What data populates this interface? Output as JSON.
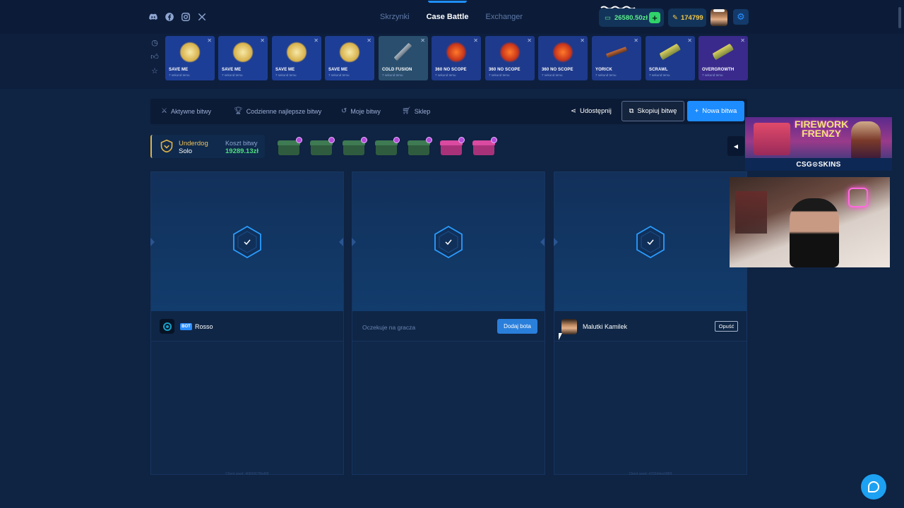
{
  "nav": {
    "links": [
      "Skrzynki",
      "Case Battle",
      "Exchanger"
    ],
    "active": "Case Battle"
  },
  "wallet": {
    "balance": "26580.50zł",
    "coins": "174799"
  },
  "drops": [
    {
      "name": "SAVE ME",
      "sub": "7 sekund temu",
      "color": "#1d3e96",
      "icon": "gold-cat-icon"
    },
    {
      "name": "SAVE ME",
      "sub": "7 sekund temu",
      "color": "#1d3e96",
      "icon": "gold-cat-icon"
    },
    {
      "name": "SAVE ME",
      "sub": "7 sekund temu",
      "color": "#1d3e96",
      "icon": "gold-cat-icon"
    },
    {
      "name": "SAVE ME",
      "sub": "7 sekund temu",
      "color": "#1d3e96",
      "icon": "gold-cat-icon"
    },
    {
      "name": "COLD FUSION",
      "sub": "7 sekund temu",
      "color": "#2a4f6e",
      "icon": "rifle-icon"
    },
    {
      "name": "360 NO SCOPE",
      "sub": "7 sekund temu",
      "color": "#1e3a8c",
      "icon": "fire-skull-icon"
    },
    {
      "name": "360 NO SCOPE",
      "sub": "7 sekund temu",
      "color": "#1e3a8c",
      "icon": "fire-skull-icon"
    },
    {
      "name": "360 NO SCOPE",
      "sub": "7 sekund temu",
      "color": "#1e3a8c",
      "icon": "fire-skull-icon"
    },
    {
      "name": "YORICK",
      "sub": "7 sekund temu",
      "color": "#1e3a8c",
      "icon": "shotgun-icon"
    },
    {
      "name": "SCRAWL",
      "sub": "7 sekund temu",
      "color": "#1e3a8c",
      "icon": "pistol-icon"
    },
    {
      "name": "OVERGROWTH",
      "sub": "7 sekund temu",
      "color": "#3a2a8c",
      "icon": "pistol-icon"
    }
  ],
  "tabs": [
    {
      "label": "Aktywne bitwy",
      "icon": "swords-icon"
    },
    {
      "label": "Codzienne najlepsze bitwy",
      "icon": "trophy-icon"
    },
    {
      "label": "Moje bitwy",
      "icon": "history-icon"
    },
    {
      "label": "Sklep",
      "icon": "basket-icon"
    }
  ],
  "actions": {
    "share": "Udostępnij",
    "copy": "Skopiuj bitwę",
    "new": "Nowa bitwa"
  },
  "battle": {
    "mode": "Underdog",
    "type": "Solo",
    "cost_label": "Koszt bitwy",
    "cost": "19289.13zł",
    "cases": [
      {
        "color": "#2f5c3e",
        "lid": "#3e7a52"
      },
      {
        "color": "#2f5c3e",
        "lid": "#3e7a52"
      },
      {
        "color": "#2f5c3e",
        "lid": "#3e7a52"
      },
      {
        "color": "#2f5c3e",
        "lid": "#3e7a52"
      },
      {
        "color": "#2f5c3e",
        "lid": "#3e7a52"
      },
      {
        "color": "#a8327a",
        "lid": "#d94aa0"
      },
      {
        "color": "#a8327a",
        "lid": "#d94aa0"
      }
    ]
  },
  "players": {
    "slot1": {
      "badge": "BOT",
      "name": "Rosso"
    },
    "slot2": {
      "waiting": "Oczekuje na gracza",
      "add_bot": "Dodaj bota"
    },
    "slot3": {
      "name": "Malutki Kamilek",
      "leave": "Opuść"
    }
  },
  "seeds": {
    "left": "Client seed: 4060067f8e89f",
    "right": "Client seed: 4702d4ec08f0f"
  },
  "promo": {
    "title": "FIREWORK\nFRENZY",
    "brand": "CSG⊙SKINS"
  },
  "colors": {
    "accent": "#1d8cff",
    "money": "#4fe07f",
    "gold": "#e0b24a"
  }
}
